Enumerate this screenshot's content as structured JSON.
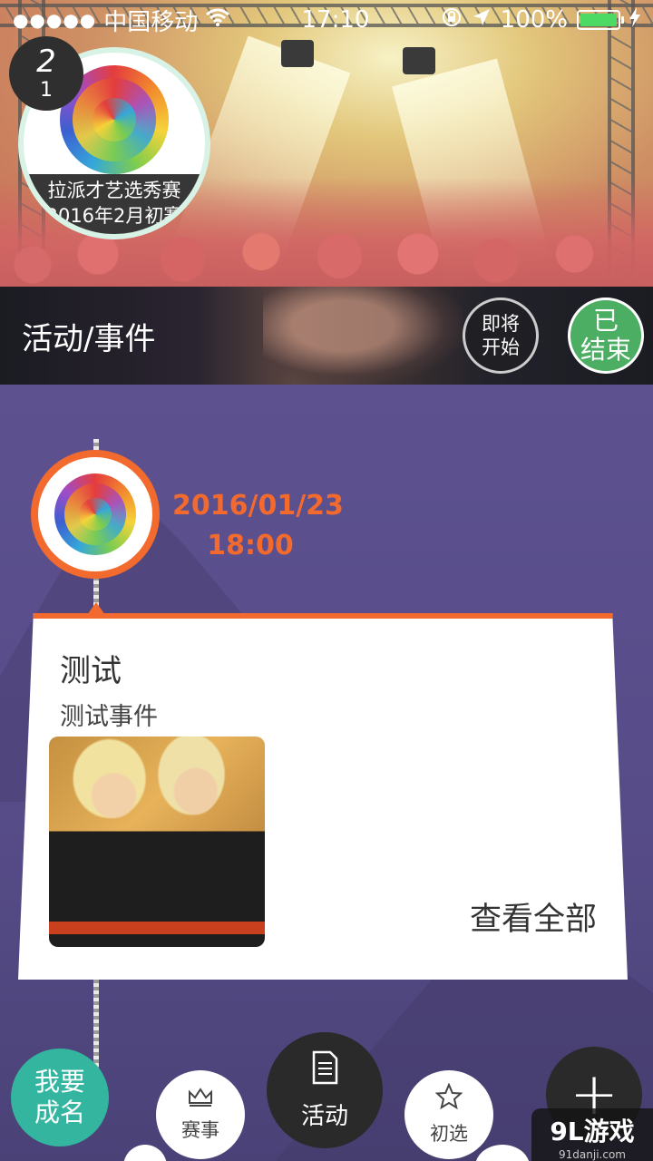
{
  "status_bar": {
    "signal_dots": "●●●●●",
    "carrier": "中国移动",
    "time": "17:10",
    "battery": "100%",
    "battery_level": 1.0
  },
  "badge": {
    "top": "2",
    "bottom": "1"
  },
  "hero": {
    "caption_line1": "拉派才艺选秀赛",
    "caption_line2": "2016年2月初赛"
  },
  "strip": {
    "title": "活动/事件",
    "upcoming_line1": "即将",
    "upcoming_line2": "开始",
    "ended_line1": "已",
    "ended_line2": "结束"
  },
  "event": {
    "date": "2016/01/23",
    "time": "18:00",
    "title": "测试",
    "description": "测试事件",
    "view_all": "查看全部"
  },
  "bottom_bar": {
    "famous_line1": "我要",
    "famous_line2": "成名",
    "contest_label": "赛事",
    "activity_label": "活动",
    "prelim_label": "初选",
    "add_label": "+"
  },
  "watermark": {
    "main": "9L游戏",
    "sub": "91danji.com"
  },
  "colors": {
    "accent": "#f26a2e",
    "ended_green": "#4cae62",
    "famous_teal": "#33b5a0",
    "timeline_bg": "#5b4f8c"
  },
  "icons": {
    "wifi": "wifi-icon",
    "lock_rotation": "rotation-lock-icon",
    "location": "location-arrow-icon",
    "charging": "charging-bolt-icon",
    "contest": "crown-icon",
    "activity": "document-icon",
    "prelim": "star-icon",
    "add": "plus-icon"
  }
}
